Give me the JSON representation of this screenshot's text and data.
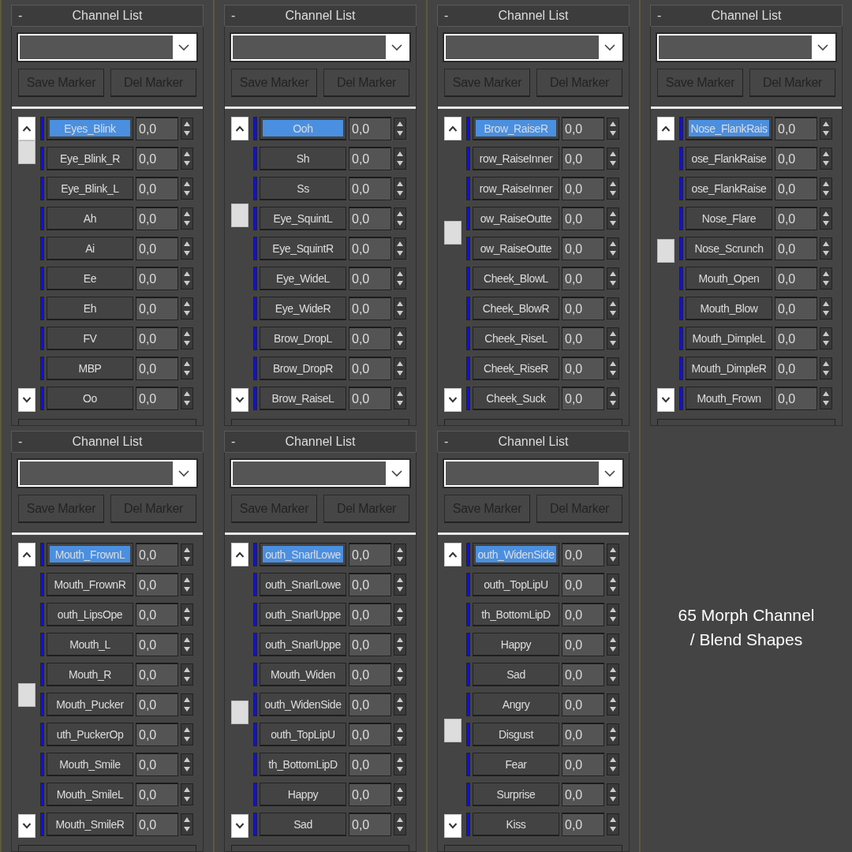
{
  "panels": [
    {
      "collapse": "-",
      "title": "Channel List",
      "buttons": [
        {
          "label": "Save Marker",
          "disabled": true
        },
        {
          "label": "Del Marker",
          "disabled": true
        }
      ],
      "channels": [
        {
          "name": "Eyes_Blink",
          "value": "0,0",
          "selected": true
        },
        {
          "name": "Eye_Blink_R",
          "value": "0,0",
          "selected": false
        },
        {
          "name": "Eye_Blink_L",
          "value": "0,0",
          "selected": false
        },
        {
          "name": "Ah",
          "value": "0,0",
          "selected": false
        },
        {
          "name": "Ai",
          "value": "0,0",
          "selected": false
        },
        {
          "name": "Ee",
          "value": "0,0",
          "selected": false
        },
        {
          "name": "Eh",
          "value": "0,0",
          "selected": false
        },
        {
          "name": "FV",
          "value": "0,0",
          "selected": false
        },
        {
          "name": "MBP",
          "value": "0,0",
          "selected": false
        },
        {
          "name": "Oo",
          "value": "0,0",
          "selected": false
        }
      ]
    },
    {
      "collapse": "-",
      "title": "Channel List",
      "buttons": [
        {
          "label": "Save Marker",
          "disabled": true
        },
        {
          "label": "Del Marker",
          "disabled": true
        }
      ],
      "channels": [
        {
          "name": "Ooh",
          "value": "0,0",
          "selected": true
        },
        {
          "name": "Sh",
          "value": "0,0",
          "selected": false
        },
        {
          "name": "Ss",
          "value": "0,0",
          "selected": false
        },
        {
          "name": "Eye_SquintL",
          "value": "0,0",
          "selected": false
        },
        {
          "name": "Eye_SquintR",
          "value": "0,0",
          "selected": false
        },
        {
          "name": "Eye_WideL",
          "value": "0,0",
          "selected": false
        },
        {
          "name": "Eye_WideR",
          "value": "0,0",
          "selected": false
        },
        {
          "name": "Brow_DropL",
          "value": "0,0",
          "selected": false
        },
        {
          "name": "Brow_DropR",
          "value": "0,0",
          "selected": false
        },
        {
          "name": "Brow_RaiseL",
          "value": "0,0",
          "selected": false
        }
      ]
    },
    {
      "collapse": "-",
      "title": "Channel List",
      "buttons": [
        {
          "label": "Save Marker",
          "disabled": true
        },
        {
          "label": "Del Marker",
          "disabled": true
        }
      ],
      "channels": [
        {
          "name": "Brow_RaiseR",
          "value": "0,0",
          "selected": true
        },
        {
          "name": "row_RaiseInner",
          "value": "0,0",
          "selected": false
        },
        {
          "name": "row_RaiseInner",
          "value": "0,0",
          "selected": false
        },
        {
          "name": "ow_RaiseOutte",
          "value": "0,0",
          "selected": false
        },
        {
          "name": "ow_RaiseOutte",
          "value": "0,0",
          "selected": false
        },
        {
          "name": "Cheek_BlowL",
          "value": "0,0",
          "selected": false
        },
        {
          "name": "Cheek_BlowR",
          "value": "0,0",
          "selected": false
        },
        {
          "name": "Cheek_RiseL",
          "value": "0,0",
          "selected": false
        },
        {
          "name": "Cheek_RiseR",
          "value": "0,0",
          "selected": false
        },
        {
          "name": "Cheek_Suck",
          "value": "0,0",
          "selected": false
        }
      ]
    },
    {
      "collapse": "-",
      "title": "Channel List",
      "buttons": [
        {
          "label": "Save Marker",
          "disabled": true
        },
        {
          "label": "Del Marker",
          "disabled": true
        }
      ],
      "channels": [
        {
          "name": "Nose_FlankRais",
          "value": "0,0",
          "selected": true
        },
        {
          "name": "ose_FlankRaise",
          "value": "0,0",
          "selected": false
        },
        {
          "name": "ose_FlankRaise",
          "value": "0,0",
          "selected": false
        },
        {
          "name": "Nose_Flare",
          "value": "0,0",
          "selected": false
        },
        {
          "name": "Nose_Scrunch",
          "value": "0,0",
          "selected": false
        },
        {
          "name": "Mouth_Open",
          "value": "0,0",
          "selected": false
        },
        {
          "name": "Mouth_Blow",
          "value": "0,0",
          "selected": false
        },
        {
          "name": "Mouth_DimpleL",
          "value": "0,0",
          "selected": false
        },
        {
          "name": "Mouth_DimpleR",
          "value": "0,0",
          "selected": false
        },
        {
          "name": "Mouth_Frown",
          "value": "0,0",
          "selected": false
        }
      ]
    },
    {
      "collapse": "-",
      "title": "Channel List",
      "buttons": [
        {
          "label": "Save Marker",
          "disabled": true
        },
        {
          "label": "Del Marker",
          "disabled": true
        }
      ],
      "channels": [
        {
          "name": "Mouth_FrownL",
          "value": "0,0",
          "selected": true
        },
        {
          "name": "Mouth_FrownR",
          "value": "0,0",
          "selected": false
        },
        {
          "name": "outh_LipsOpe",
          "value": "0,0",
          "selected": false
        },
        {
          "name": "Mouth_L",
          "value": "0,0",
          "selected": false
        },
        {
          "name": "Mouth_R",
          "value": "0,0",
          "selected": false
        },
        {
          "name": "Mouth_Pucker",
          "value": "0,0",
          "selected": false
        },
        {
          "name": "uth_PuckerOp",
          "value": "0,0",
          "selected": false
        },
        {
          "name": "Mouth_Smile",
          "value": "0,0",
          "selected": false
        },
        {
          "name": "Mouth_SmileL",
          "value": "0,0",
          "selected": false
        },
        {
          "name": "Mouth_SmileR",
          "value": "0,0",
          "selected": false
        }
      ]
    },
    {
      "collapse": "-",
      "title": "Channel List",
      "buttons": [
        {
          "label": "Save Marker",
          "disabled": true
        },
        {
          "label": "Del Marker",
          "disabled": true
        }
      ],
      "channels": [
        {
          "name": "outh_SnarlLowe",
          "value": "0,0",
          "selected": true
        },
        {
          "name": "outh_SnarlLowe",
          "value": "0,0",
          "selected": false
        },
        {
          "name": "outh_SnarlUppe",
          "value": "0,0",
          "selected": false
        },
        {
          "name": "outh_SnarlUppe",
          "value": "0,0",
          "selected": false
        },
        {
          "name": "Mouth_Widen",
          "value": "0,0",
          "selected": false
        },
        {
          "name": "outh_WidenSide",
          "value": "0,0",
          "selected": false
        },
        {
          "name": "outh_TopLipU",
          "value": "0,0",
          "selected": false
        },
        {
          "name": "th_BottomLipD",
          "value": "0,0",
          "selected": false
        },
        {
          "name": "Happy",
          "value": "0,0",
          "selected": false
        },
        {
          "name": "Sad",
          "value": "0,0",
          "selected": false
        }
      ]
    },
    {
      "collapse": "-",
      "title": "Channel List",
      "buttons": [
        {
          "label": "Save Marker",
          "disabled": true
        },
        {
          "label": "Del Marker",
          "disabled": true
        }
      ],
      "channels": [
        {
          "name": "outh_WidenSide",
          "value": "0,0",
          "selected": true
        },
        {
          "name": "outh_TopLipU",
          "value": "0,0",
          "selected": false
        },
        {
          "name": "th_BottomLipD",
          "value": "0,0",
          "selected": false
        },
        {
          "name": "Happy",
          "value": "0,0",
          "selected": false
        },
        {
          "name": "Sad",
          "value": "0,0",
          "selected": false
        },
        {
          "name": "Angry",
          "value": "0,0",
          "selected": false
        },
        {
          "name": "Disgust",
          "value": "0,0",
          "selected": false
        },
        {
          "name": "Fear",
          "value": "0,0",
          "selected": false
        },
        {
          "name": "Surprise",
          "value": "0,0",
          "selected": false
        },
        {
          "name": "Kiss",
          "value": "0,0",
          "selected": false
        }
      ]
    }
  ],
  "caption": [
    "65 Morph Channel",
    "/ Blend Shapes"
  ]
}
